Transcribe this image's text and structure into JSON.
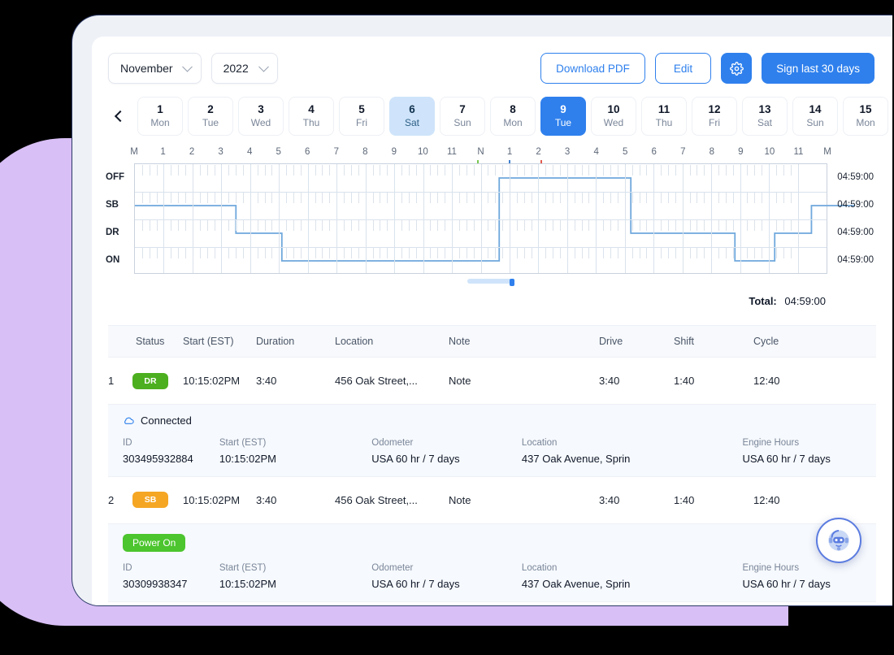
{
  "header": {
    "month": "November",
    "year": "2022",
    "download_pdf": "Download PDF",
    "edit": "Edit",
    "settings_icon": "gear-icon",
    "sign_last_30": "Sign last 30 days"
  },
  "daystrip": {
    "prev_icon": "chevron-left-icon",
    "next_icon": "chevron-right-icon",
    "days": [
      {
        "num": "1",
        "dow": "Mon",
        "state": "normal"
      },
      {
        "num": "2",
        "dow": "Tue",
        "state": "normal"
      },
      {
        "num": "3",
        "dow": "Wed",
        "state": "normal"
      },
      {
        "num": "4",
        "dow": "Thu",
        "state": "normal"
      },
      {
        "num": "5",
        "dow": "Fri",
        "state": "normal"
      },
      {
        "num": "6",
        "dow": "Sat",
        "state": "soft"
      },
      {
        "num": "7",
        "dow": "Sun",
        "state": "normal"
      },
      {
        "num": "8",
        "dow": "Mon",
        "state": "normal"
      },
      {
        "num": "9",
        "dow": "Tue",
        "state": "active"
      },
      {
        "num": "10",
        "dow": "Wed",
        "state": "normal"
      },
      {
        "num": "11",
        "dow": "Thu",
        "state": "normal"
      },
      {
        "num": "12",
        "dow": "Fri",
        "state": "normal"
      },
      {
        "num": "13",
        "dow": "Sat",
        "state": "normal"
      },
      {
        "num": "14",
        "dow": "Sun",
        "state": "normal"
      },
      {
        "num": "15",
        "dow": "Mon",
        "state": "normal"
      }
    ]
  },
  "chart_data": {
    "type": "line",
    "title": "",
    "xlabel": "",
    "ylabel": "",
    "hour_labels": [
      "M",
      "1",
      "2",
      "3",
      "4",
      "5",
      "6",
      "7",
      "8",
      "9",
      "10",
      "11",
      "N",
      "1",
      "2",
      "3",
      "4",
      "5",
      "6",
      "7",
      "8",
      "9",
      "10",
      "11",
      "M"
    ],
    "statuses": [
      "OFF",
      "SB",
      "DR",
      "ON"
    ],
    "row_totals": [
      "04:59:00",
      "04:59:00",
      "04:59:00",
      "04:59:00"
    ],
    "total_label": "Total:",
    "total_value": "04:59:00",
    "line_color": "#6FA8DC",
    "grid": true,
    "event_markers": [
      {
        "hour": 11.9,
        "color": "#79C753"
      },
      {
        "hour": 13.0,
        "color": "#3F7FD0"
      },
      {
        "hour": 14.1,
        "color": "#E05A4E"
      }
    ],
    "segments": [
      {
        "status": "SB",
        "start_hour": 0.0,
        "end_hour": 3.3
      },
      {
        "status": "DR",
        "start_hour": 3.3,
        "end_hour": 4.8
      },
      {
        "status": "ON",
        "start_hour": 4.8,
        "end_hour": 11.9
      },
      {
        "status": "OFF",
        "start_hour": 11.9,
        "end_hour": 16.2
      },
      {
        "status": "DR",
        "start_hour": 16.2,
        "end_hour": 19.6
      },
      {
        "status": "ON",
        "start_hour": 19.6,
        "end_hour": 20.9
      },
      {
        "status": "DR",
        "start_hour": 20.9,
        "end_hour": 22.1
      },
      {
        "status": "SB",
        "start_hour": 22.1,
        "end_hour": 23.5
      }
    ],
    "scrollbar": {
      "visible": true
    }
  },
  "table": {
    "columns": [
      "",
      "Status",
      "Start (EST)",
      "Duration",
      "Location",
      "Note",
      "Drive",
      "Shift",
      "Cycle"
    ],
    "rows": [
      {
        "index": "1",
        "status": "DR",
        "status_kind": "dr",
        "start": "10:15:02PM",
        "duration": "3:40",
        "location": "456 Oak Street,...",
        "note": "Note",
        "drive": "3:40",
        "shift": "1:40",
        "cycle": "12:40"
      },
      {
        "index": "2",
        "status": "SB",
        "status_kind": "sb",
        "start": "10:15:02PM",
        "duration": "3:40",
        "location": "456 Oak Street,...",
        "note": "Note",
        "drive": "3:40",
        "shift": "1:40",
        "cycle": "12:40"
      }
    ],
    "panels": [
      {
        "kind": "connected",
        "title": "Connected",
        "icon": "cloud-connected-icon",
        "fields": {
          "id_label": "ID",
          "id_value": "303495932884",
          "start_label": "Start (EST)",
          "start_value": "10:15:02PM",
          "odometer_label": "Odometer",
          "odometer_value": "USA 60 hr / 7 days",
          "location_label": "Location",
          "location_value": "437 Oak Avenue, Sprin",
          "engine_label": "Engine Hours",
          "engine_value": "USA 60 hr / 7 days"
        }
      },
      {
        "kind": "power-on",
        "title": "Power On",
        "icon": "",
        "fields": {
          "id_label": "ID",
          "id_value": "30309938347",
          "start_label": "Start (EST)",
          "start_value": "10:15:02PM",
          "odometer_label": "Odometer",
          "odometer_value": "USA 60 hr / 7 days",
          "location_label": "Location",
          "location_value": "437 Oak Avenue, Sprin",
          "engine_label": "Engine Hours",
          "engine_value": "USA 60 hr / 7 days"
        }
      }
    ]
  },
  "chatbot": {
    "icon": "robot-assistant-icon"
  },
  "colors": {
    "accent": "#2F80ED",
    "soft_accent": "#CFE4FA",
    "dr_badge": "#4CAF1F",
    "sb_badge": "#F5A623",
    "power_on": "#4CC52E",
    "chart_line": "#6FA8DC",
    "backdrop_purple": "#D8BFF5"
  }
}
